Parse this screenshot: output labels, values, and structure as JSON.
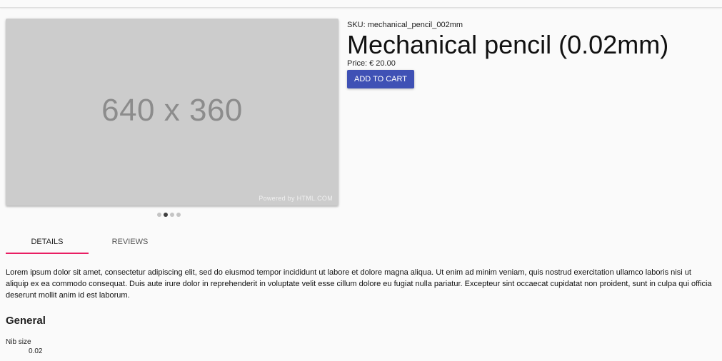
{
  "product": {
    "sku_prefix": "SKU:",
    "sku": "mechanical_pencil_002mm",
    "title": "Mechanical pencil (0.02mm)",
    "price_label": "Price:",
    "price_value": "€ 20.00",
    "add_to_cart_label": "ADD TO CART"
  },
  "gallery": {
    "placeholder_text": "640 x 360",
    "watermark": "Powered by HTML.COM",
    "slide_count": 4,
    "active_slide": 2
  },
  "tabs": [
    {
      "label": "DETAILS",
      "active": true
    },
    {
      "label": "REVIEWS",
      "active": false
    }
  ],
  "details": {
    "description": "Lorem ipsum dolor sit amet, consectetur adipiscing elit, sed do eiusmod tempor incididunt ut labore et dolore magna aliqua. Ut enim ad minim veniam, quis nostrud exercitation ullamco laboris nisi ut aliquip ex ea commodo consequat. Duis aute irure dolor in reprehenderit in voluptate velit esse cillum dolore eu fugiat nulla pariatur. Excepteur sint occaecat cupidatat non proident, sunt in culpa qui officia deserunt mollit anim id est laborum.",
    "section_heading": "General",
    "specs": [
      {
        "label": "Nib size",
        "value": "0.02"
      }
    ]
  },
  "colors": {
    "primary_button": "#3f51b5",
    "tab_indicator": "#e91e63",
    "placeholder_bg": "#cccccc"
  }
}
